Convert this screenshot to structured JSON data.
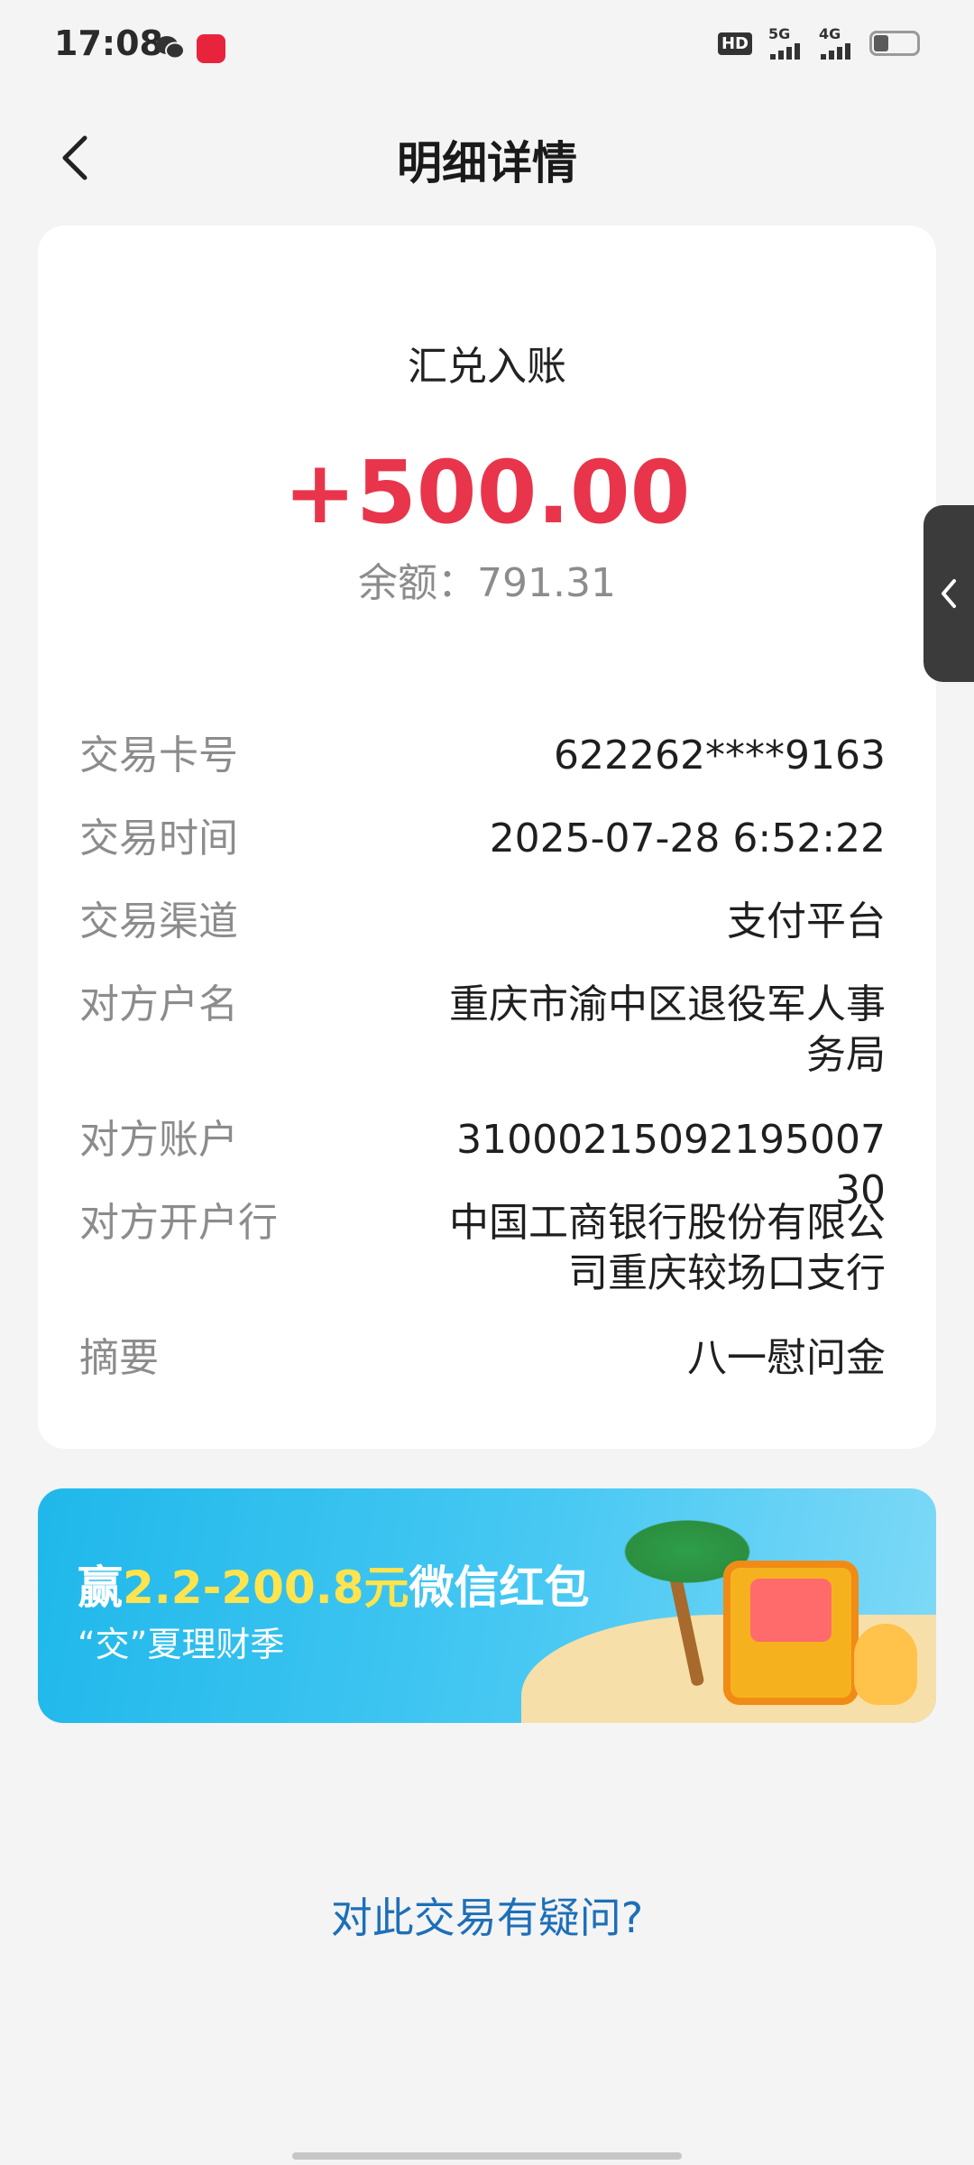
{
  "status_bar": {
    "time": "17:08",
    "hd": "HD",
    "net_1": "5G",
    "net_2": "4G",
    "app_icon": "xiaohongshu-icon",
    "chat_icon": "wechat-icon"
  },
  "header": {
    "title": "明细详情",
    "back_icon": "chevron-left-icon"
  },
  "summary": {
    "type": "汇兑入账",
    "amount": "+500.00",
    "balance": "余额：791.31",
    "amount_color": "#e8354c"
  },
  "details": [
    {
      "label": "交易卡号",
      "value": "622262****9163"
    },
    {
      "label": "交易时间",
      "value": "2025-07-28 6:52:22"
    },
    {
      "label": "交易渠道",
      "value": "支付平台"
    },
    {
      "label": "对方户名",
      "value_line1": "重庆市渝中区退役军人事",
      "value_line2": "务局"
    },
    {
      "label": "对方账户",
      "value": "31000215092195007 30"
    },
    {
      "label": "对方开户行",
      "value_line1": "中国工商银行股份有限公",
      "value_line2": "司重庆较场口支行"
    },
    {
      "label": "摘要",
      "value": "八一慰问金"
    }
  ],
  "banner": {
    "prefix": "赢",
    "highlight": "2.2-200.8元",
    "suffix": "微信红包",
    "subtitle": "“交”夏理财季"
  },
  "dispute_link": "对此交易有疑问?",
  "colors": {
    "link": "#1d6fb8",
    "banner_start": "#1fb8ea",
    "highlight": "#ffe44d"
  }
}
